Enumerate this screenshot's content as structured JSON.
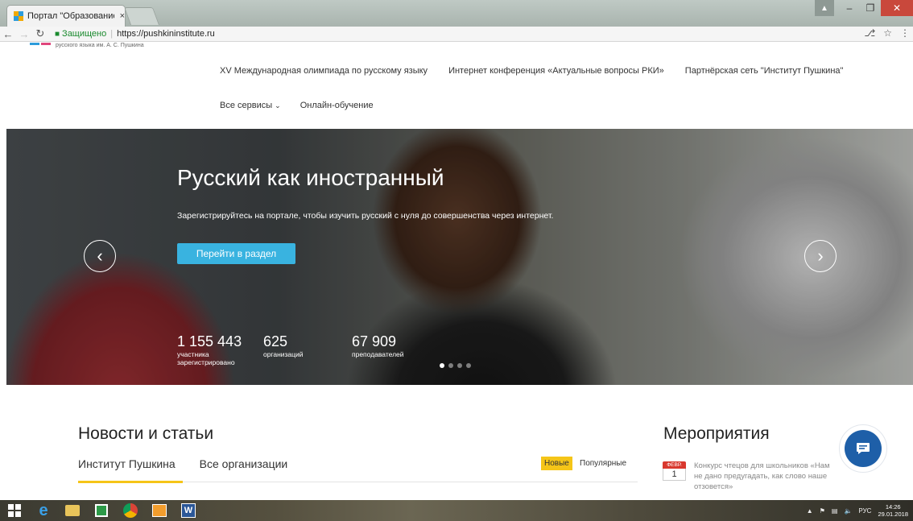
{
  "browser": {
    "tab_title": "Портал \"Образование н",
    "tab_close": "×",
    "security_label": "Защищено",
    "url": "https://pushkininstitute.ru",
    "key_icon": "key-icon",
    "star_icon": "star-icon",
    "menu_icon": "more-vert-icon"
  },
  "header": {
    "logo_subtitle": "русского языка им. А. С. Пушкина",
    "nav_row1": [
      {
        "label": "XV Международная олимпиада по русскому языку"
      },
      {
        "label": "Интернет конференция «Актуальные вопросы РКИ»"
      },
      {
        "label": "Партнёрская сеть \"Институт Пушкина\""
      }
    ],
    "nav_row2": [
      {
        "label": "Все сервисы"
      },
      {
        "label": "Онлайн-обучение"
      }
    ]
  },
  "hero": {
    "title": "Русский как иностранный",
    "subtitle": "Зарегистрируйтесь на портале, чтобы изучить русский с нуля до совершенства через интернет.",
    "button": "Перейти в раздел",
    "stats": [
      {
        "value": "1 155 443",
        "label1": "участника",
        "label2": "зарегистрировано"
      },
      {
        "value": "625",
        "label1": "организаций",
        "label2": ""
      },
      {
        "value": "67 909",
        "label1": "преподавателей",
        "label2": ""
      }
    ],
    "slides_total": 4,
    "slide_active": 1
  },
  "news": {
    "title": "Новости и статьи",
    "tabs": [
      {
        "label": "Институт Пушкина"
      },
      {
        "label": "Все организации"
      }
    ],
    "filter_new": "Новые",
    "filter_popular": "Популярные"
  },
  "events": {
    "title": "Мероприятия",
    "items": [
      {
        "month": "ФЕВР.",
        "day": "1",
        "text": "Конкурс чтецов для школьников «Нам не дано предугадать, как слово наше отзовется»"
      }
    ]
  },
  "taskbar": {
    "lang": "РУС",
    "time": "14:26",
    "date": "29.01.2018"
  },
  "colors": {
    "accent_blue": "#39b3e0",
    "accent_yellow": "#f5c518",
    "event_red": "#d9382e",
    "chat_blue": "#1e5fa8"
  }
}
